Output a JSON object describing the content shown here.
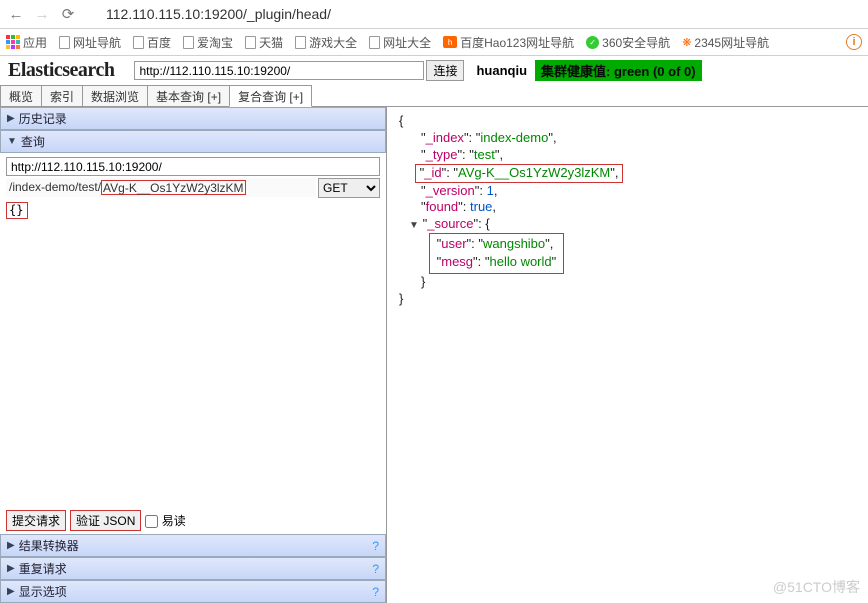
{
  "browser": {
    "url": "112.110.115.10:19200/_plugin/head/",
    "bookmarks": [
      "应用",
      "网址导航",
      "百度",
      "爱淘宝",
      "天猫",
      "游戏大全",
      "网址大全",
      "百度Hao123网址导航",
      "360安全导航",
      "2345网址导航"
    ]
  },
  "app": {
    "logo": "Elasticsearch",
    "connect_url": "http://112.110.115.10:19200/",
    "connect_btn": "连接",
    "user": "huanqiu",
    "health": "集群健康值: green (0 of 0)"
  },
  "tabs": [
    "概览",
    "索引",
    "数据浏览",
    "基本查询 [+]",
    "复合查询 [+]"
  ],
  "left": {
    "history": "历史记录",
    "query": "查询",
    "host": "http://112.110.115.10:19200/",
    "path_prefix": "/index-demo/test/",
    "path_id": "AVg-K__Os1YzW2y3lzKM",
    "method": "GET",
    "json_body": "{}",
    "submit": "提交请求",
    "validate": "验证 JSON",
    "pretty": "易读",
    "transformer": "结果转换器",
    "repeat": "重复请求",
    "display": "显示选项"
  },
  "json": {
    "_index": "index-demo",
    "_type": "test",
    "_id": "AVg-K__Os1YzW2y3lzKM",
    "_version": 1,
    "found": true,
    "_source": {
      "user": "wangshibo",
      "mesg": "hello world"
    }
  },
  "watermark": "@51CTO博客"
}
